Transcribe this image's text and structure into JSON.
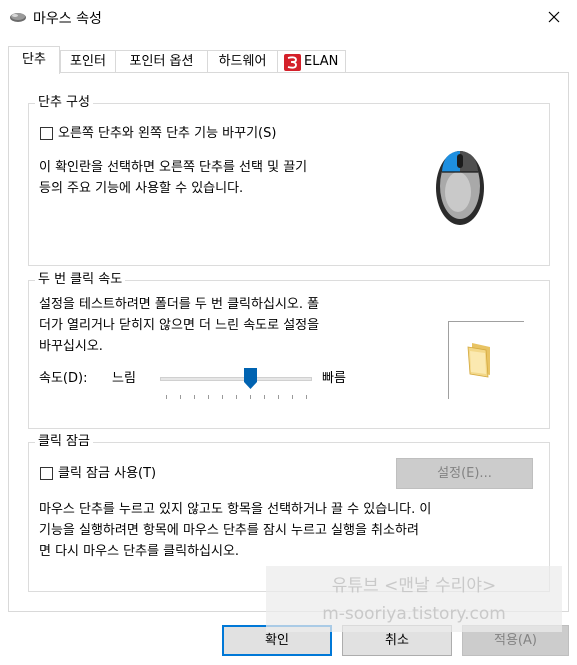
{
  "window": {
    "title": "마우스 속성",
    "icon": "mouse-icon",
    "close_icon": "close-icon"
  },
  "tabs": [
    {
      "label": "단추",
      "active": true
    },
    {
      "label": "포인터",
      "active": false
    },
    {
      "label": "포인터 옵션",
      "active": false
    },
    {
      "label": "하드웨어",
      "active": false
    },
    {
      "label": "ELAN",
      "active": false,
      "icon": "elan-logo-icon"
    }
  ],
  "button_config": {
    "legend": "단추 구성",
    "swap_checkbox_label": "오른쪽 단추와 왼쪽 단추 기능 바꾸기(S)",
    "swap_checked": false,
    "description_lines": [
      "이 확인란을 선택하면 오른쪽 단추를 선택 및 끌기",
      "등의 주요 기능에 사용할 수 있습니다."
    ],
    "illustration": "mouse-illustration-icon"
  },
  "double_click": {
    "legend": "두 번 클릭 속도",
    "description_lines": [
      "설정을 테스트하려면 폴더를 두 번 클릭하십시오. 폴",
      "더가 열리거나 닫히지 않으면 더 느린 속도로 설정을",
      "바꾸십시오."
    ],
    "speed_label": "속도(D):",
    "slow_label": "느림",
    "fast_label": "빠름",
    "speed_level": 0.6,
    "test_icon": "folder-icon"
  },
  "click_lock": {
    "legend": "클릭 잠금",
    "checkbox_label": "클릭 잠금 사용(T)",
    "checked": false,
    "settings_button": "설정(E)...",
    "description_lines": [
      "마우스 단추를 누르고 있지 않고도 항목을 선택하거나 끌 수 있습니다. 이",
      "기능을 실행하려면 항목에 마우스 단추를 잠시 누르고 실행을 취소하려",
      "면 다시 마우스 단추를 클릭하십시오."
    ]
  },
  "footer": {
    "ok": "확인",
    "cancel": "취소",
    "apply": "적용(A)"
  },
  "watermark": {
    "line1": "유튜브 <맨날 수리야>",
    "line2": "m-sooriya.tistory.com"
  },
  "colors": {
    "accent": "#0078d7",
    "slider_thumb": "#0063b1",
    "mouse_blue": "#1e8fe0"
  }
}
